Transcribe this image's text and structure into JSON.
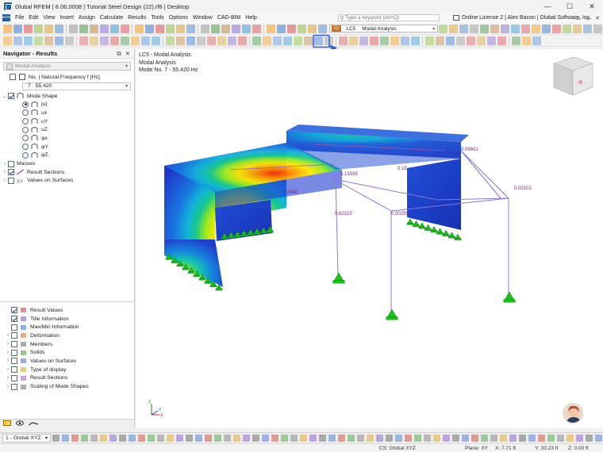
{
  "window": {
    "title": "Dlubal RFEM | 6.06.0008 | Tutorial Steel Design (22).rf6 | Desktop",
    "minimize": "—",
    "maximize": "☐",
    "close": "✕"
  },
  "menu": {
    "items": [
      "File",
      "Edit",
      "View",
      "Insert",
      "Assign",
      "Calculate",
      "Results",
      "Tools",
      "Options",
      "Window",
      "CAD-BIM",
      "Help"
    ],
    "search_placeholder": "Type a keyword (Alt+Q)",
    "license": "Online License 2 | Alex Bacon | Dlubal Software, Inc."
  },
  "loadcase": {
    "tag": "Cr",
    "code": "LC5",
    "name": "Modal Analysis"
  },
  "navigator": {
    "title": "Navigator - Results",
    "combo": "Modal Analysis",
    "freq_label": "No. | Natural Frequency f [Hz]",
    "freq_value_no": "7",
    "freq_value": "55.420",
    "mode_shape": "Mode Shape",
    "mode_options": [
      "|u|",
      "ux",
      "uY",
      "uZ",
      "φx",
      "φY",
      "φZ"
    ],
    "groups": [
      "Masses",
      "Result Sections",
      "Values on Surfaces"
    ],
    "lower": [
      "Result Values",
      "Title Information",
      "Max/Min Information",
      "Deformation",
      "Members",
      "Solids",
      "Values on Surfaces",
      "Type of display",
      "Result Sections",
      "Scaling of Mode Shapes"
    ]
  },
  "viewport": {
    "info": [
      "LC5 - Modal Analysis",
      "Modal Analysis",
      "Mode No. 7 - 55.420 Hz"
    ],
    "labels": [
      "0.09601",
      "0.00101",
      "0.62315",
      "0.18",
      "0.13939",
      "0.00250",
      "0.0000"
    ],
    "cube_label": "-X",
    "axes": [
      "X",
      "Y",
      "Z"
    ]
  },
  "bottom": {
    "coord_system": "1 - Global XYZ"
  },
  "status": {
    "cs": "CS: Global XYZ",
    "plane": "Plane: XY",
    "x": "X: 7.71 ft",
    "y": "Y: 33.23 ft",
    "z": "Z: 0.00 ft"
  },
  "colors": {
    "accent": "#1f5fa8",
    "highlight": "#3b63d6",
    "support": "#19c419"
  }
}
